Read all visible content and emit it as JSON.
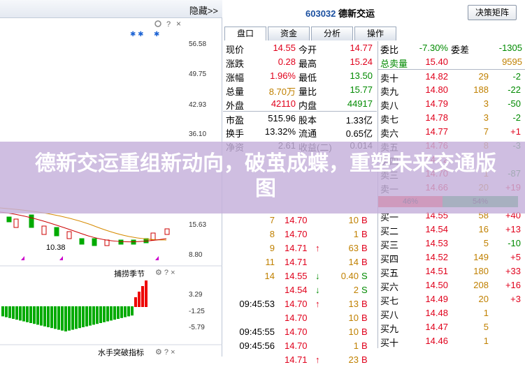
{
  "left": {
    "hide_label": "隐藏>>",
    "y_labels": [
      "56.58",
      "49.75",
      "42.93",
      "36.10",
      "15.63",
      "8.80",
      "3.29",
      "-1.25",
      "-5.79"
    ],
    "ma_label": "10.38",
    "indicator1": "捕捞季节",
    "indicator2": "水手突破指标"
  },
  "header": {
    "code": "603032",
    "name": "德新交运",
    "wizard_button": "决策矩阵"
  },
  "tabs": [
    "盘口",
    "资金",
    "分析",
    "操作"
  ],
  "quote": [
    {
      "l1": "现价",
      "v1": "14.55",
      "c1": "red",
      "l2": "今开",
      "v2": "14.77",
      "c2": "red"
    },
    {
      "l1": "涨跌",
      "v1": "0.28",
      "c1": "red",
      "l2": "最高",
      "v2": "15.24",
      "c2": "red"
    },
    {
      "l1": "涨幅",
      "v1": "1.96%",
      "c1": "red",
      "l2": "最低",
      "v2": "13.50",
      "c2": "green"
    },
    {
      "l1": "总量",
      "v1": "8.70万",
      "c1": "olive",
      "l2": "量比",
      "v2": "15.77",
      "c2": "green"
    },
    {
      "l1": "外盘",
      "v1": "42110",
      "c1": "red",
      "l2": "内盘",
      "v2": "44917",
      "c2": "green"
    },
    {
      "l1": "市盈",
      "v1": "515.96",
      "c1": "black",
      "l2": "股本",
      "v2": "1.33亿",
      "c2": "black"
    },
    {
      "l1": "换手",
      "v1": "13.32%",
      "c1": "black",
      "l2": "流通",
      "v2": "0.65亿",
      "c2": "black"
    },
    {
      "l1": "净资",
      "v1": "2.61",
      "c1": "black",
      "l2": "收益(二)",
      "v2": "0.014",
      "c2": "black"
    }
  ],
  "orderbook_top": [
    {
      "label": "委比",
      "v1": "-7.30%",
      "c1": "green",
      "v2label": "委差",
      "v2": "-1305",
      "c2": "green"
    },
    {
      "label": "总卖量",
      "v1": "15.40",
      "c1": "red",
      "v2label": "",
      "v2": "9595",
      "c2": "olive"
    }
  ],
  "sells": [
    {
      "label": "卖十",
      "price": "14.82",
      "vol": "29",
      "chg": "-2"
    },
    {
      "label": "卖九",
      "price": "14.80",
      "vol": "188",
      "chg": "-22"
    },
    {
      "label": "卖八",
      "price": "14.79",
      "vol": "3",
      "chg": "-50"
    },
    {
      "label": "卖七",
      "price": "14.78",
      "vol": "3",
      "chg": "-2"
    },
    {
      "label": "卖六",
      "price": "14.77",
      "vol": "7",
      "chg": "+1"
    },
    {
      "label": "卖五",
      "price": "14.76",
      "vol": "8",
      "chg": "-3"
    },
    {
      "label": "卖四",
      "price": "14.72",
      "vol": "",
      "chg": ""
    },
    {
      "label": "卖三",
      "price": "14.70",
      "vol": "1",
      "chg": "-87"
    },
    {
      "label": "卖一",
      "price": "14.66",
      "vol": "20",
      "chg": "+19"
    }
  ],
  "ratio": {
    "buy": "46%",
    "sell": "54%",
    "buy_fraction": 0.46
  },
  "buys": [
    {
      "label": "买一",
      "price": "14.55",
      "vol": "58",
      "chg": "+40"
    },
    {
      "label": "买二",
      "price": "14.54",
      "vol": "16",
      "chg": "+13"
    },
    {
      "label": "买三",
      "price": "14.53",
      "vol": "5",
      "chg": "-10"
    },
    {
      "label": "买四",
      "price": "14.52",
      "vol": "149",
      "chg": "+5"
    },
    {
      "label": "买五",
      "price": "14.51",
      "vol": "180",
      "chg": "+33"
    },
    {
      "label": "买六",
      "price": "14.50",
      "vol": "208",
      "chg": "+16"
    },
    {
      "label": "买七",
      "price": "14.49",
      "vol": "20",
      "chg": "+3"
    },
    {
      "label": "买八",
      "price": "14.48",
      "vol": "1",
      "chg": ""
    },
    {
      "label": "买九",
      "price": "14.47",
      "vol": "5",
      "chg": ""
    },
    {
      "label": "买十",
      "price": "14.46",
      "vol": "1",
      "chg": ""
    }
  ],
  "ticks": [
    {
      "time": "",
      "price": "14.70",
      "arrow": "",
      "vol": "10",
      "side": "B"
    },
    {
      "time": "",
      "price": "14.70",
      "arrow": "",
      "vol": "1",
      "side": "B"
    },
    {
      "time": "",
      "price": "14.71",
      "arrow": "↑",
      "vol": "63",
      "side": "B"
    },
    {
      "time": "",
      "price": "14.71",
      "arrow": "",
      "vol": "14",
      "side": "B"
    },
    {
      "time": "",
      "price": "14.55",
      "arrow": "↓",
      "vol": "0.40",
      "side": "S"
    },
    {
      "time": "",
      "price": "14.54",
      "arrow": "↓",
      "vol": "2",
      "side": "S"
    },
    {
      "time": "09:45:53",
      "price": "14.70",
      "arrow": "↑",
      "vol": "13",
      "side": "B"
    },
    {
      "time": "",
      "price": "14.70",
      "arrow": "",
      "vol": "10",
      "side": "B"
    },
    {
      "time": "09:45:55",
      "price": "14.70",
      "arrow": "",
      "vol": "10",
      "side": "B"
    },
    {
      "time": "09:45:56",
      "price": "14.70",
      "arrow": "",
      "vol": "1",
      "side": "B"
    },
    {
      "time": "",
      "price": "14.71",
      "arrow": "↑",
      "vol": "23",
      "side": "B"
    }
  ],
  "tick_leads": [
    "7",
    "8",
    "9",
    "11",
    "14",
    "09:45:53"
  ],
  "overlay_title": "德新交运重组新动向，破茧成蝶，重塑未来交通版图"
}
